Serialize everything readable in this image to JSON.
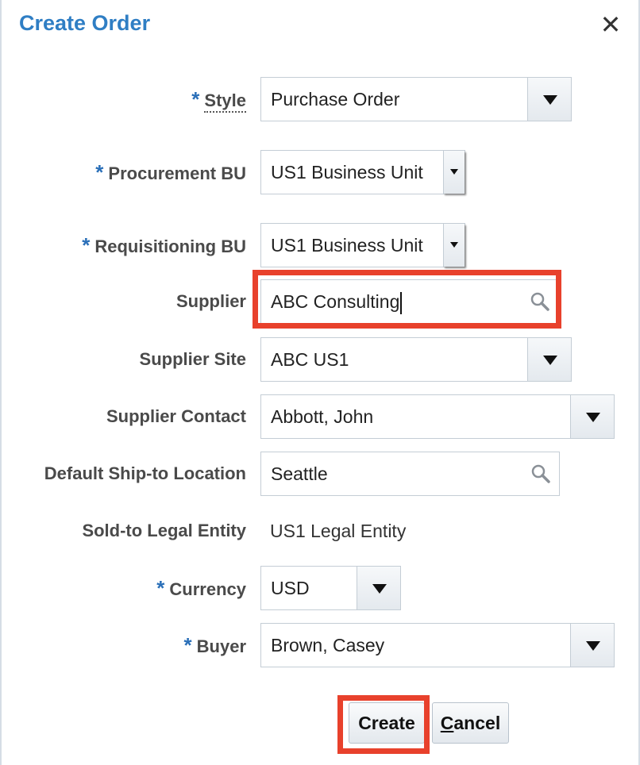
{
  "dialog": {
    "title": "Create Order",
    "close_symbol": "✕"
  },
  "form": {
    "style": {
      "label": "Style",
      "value": "Purchase Order",
      "required": true
    },
    "procurement_bu": {
      "label": "Procurement BU",
      "value": "US1 Business Unit",
      "required": true
    },
    "requisitioning_bu": {
      "label": "Requisitioning BU",
      "value": "US1 Business Unit",
      "required": true
    },
    "supplier": {
      "label": "Supplier",
      "value": "ABC Consulting",
      "required": false
    },
    "supplier_site": {
      "label": "Supplier Site",
      "value": "ABC US1",
      "required": false
    },
    "supplier_contact": {
      "label": "Supplier Contact",
      "value": "Abbott, John",
      "required": false
    },
    "ship_to": {
      "label": "Default Ship-to Location",
      "value": "Seattle",
      "required": false
    },
    "sold_to": {
      "label": "Sold-to Legal Entity",
      "value": "US1 Legal Entity",
      "required": false
    },
    "currency": {
      "label": "Currency",
      "value": "USD",
      "required": true
    },
    "buyer": {
      "label": "Buyer",
      "value": "Brown, Casey",
      "required": true
    }
  },
  "required_marker": "*",
  "buttons": {
    "create": "Create",
    "cancel_first": "C",
    "cancel_rest": "ancel"
  },
  "colors": {
    "title": "#2f7ec4",
    "required": "#2a6fb8",
    "highlight": "#e8412c"
  },
  "icons": {
    "search": "magnifier-icon",
    "dropdown": "triangle-down-icon",
    "close": "close-icon"
  }
}
